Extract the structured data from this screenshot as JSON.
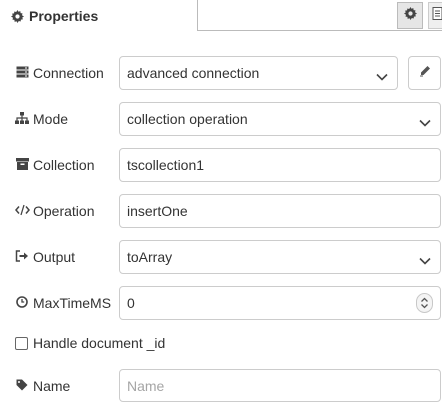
{
  "header": {
    "title": "Properties"
  },
  "form": {
    "connection": {
      "label": "Connection",
      "value": "advanced connection"
    },
    "mode": {
      "label": "Mode",
      "value": "collection operation"
    },
    "collection": {
      "label": "Collection",
      "value": "tscollection1"
    },
    "operation": {
      "label": "Operation",
      "value": "insertOne"
    },
    "output": {
      "label": "Output",
      "value": "toArray"
    },
    "maxtimems": {
      "label": "MaxTimeMS",
      "value": "0"
    },
    "handle_id": {
      "label": "Handle document _id",
      "checked": false
    },
    "name": {
      "label": "Name",
      "value": "",
      "placeholder": "Name"
    }
  },
  "icons": {
    "header": "gear-icon",
    "connection": "server-icon",
    "mode": "sitemap-icon",
    "collection": "archive-icon",
    "operation": "code-icon",
    "output": "sign-out-icon",
    "maxtimems": "clock-icon",
    "name": "tag-icon"
  }
}
